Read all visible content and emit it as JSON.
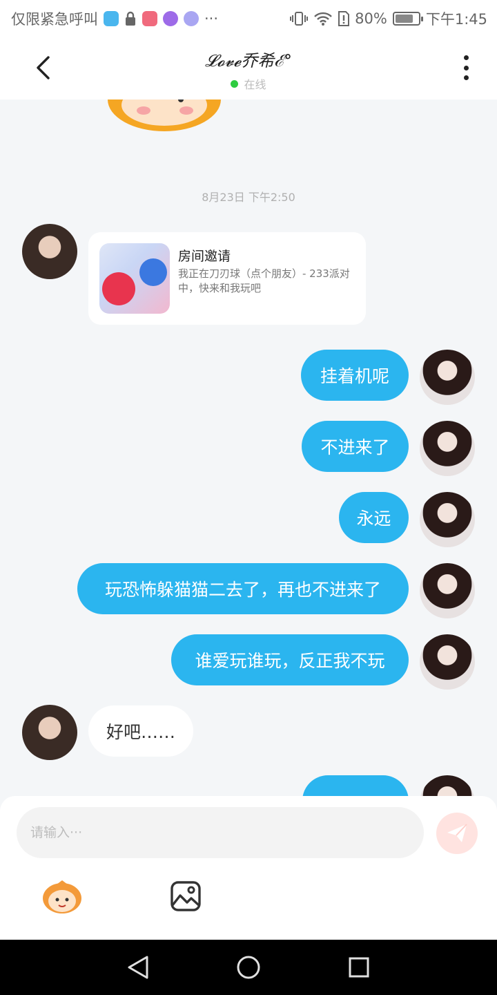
{
  "status_bar": {
    "left_text": "仅限紧急呼叫",
    "ellipsis": "···",
    "battery_text": "80%",
    "battery_level": 0.8,
    "time": "下午1:45"
  },
  "header": {
    "title": "𝓛𝓸𝓿𝓮乔希ℰ°",
    "status": "在线",
    "status_color": "#2ecc40"
  },
  "chat": {
    "timestamp": "8月23日 下午2:50",
    "invite": {
      "title": "房间邀请",
      "description": "我正在刀刃球（点个朋友）- 233派对中，快来和我玩吧"
    },
    "messages": [
      {
        "side": "self",
        "text": "挂着机呢"
      },
      {
        "side": "self",
        "text": "不进来了"
      },
      {
        "side": "self",
        "text": "永远"
      },
      {
        "side": "self",
        "text": "玩恐怖躲猫猫二去了，再也不进来了"
      },
      {
        "side": "self",
        "text": "谁爱玩谁玩，反正我不玩"
      },
      {
        "side": "other",
        "text": "好吧……"
      },
      {
        "side": "self",
        "text": "…"
      }
    ],
    "bubble_color": "#2bb5ef"
  },
  "input": {
    "placeholder": "请输入···",
    "value": ""
  },
  "icons": {
    "back": "chevron-left-icon",
    "more": "more-vertical-icon",
    "send": "send-icon",
    "emoji": "emoji-sticker-icon",
    "image": "image-icon",
    "nav_back": "triangle-back-icon",
    "nav_home": "circle-home-icon",
    "nav_recent": "square-recent-icon"
  }
}
